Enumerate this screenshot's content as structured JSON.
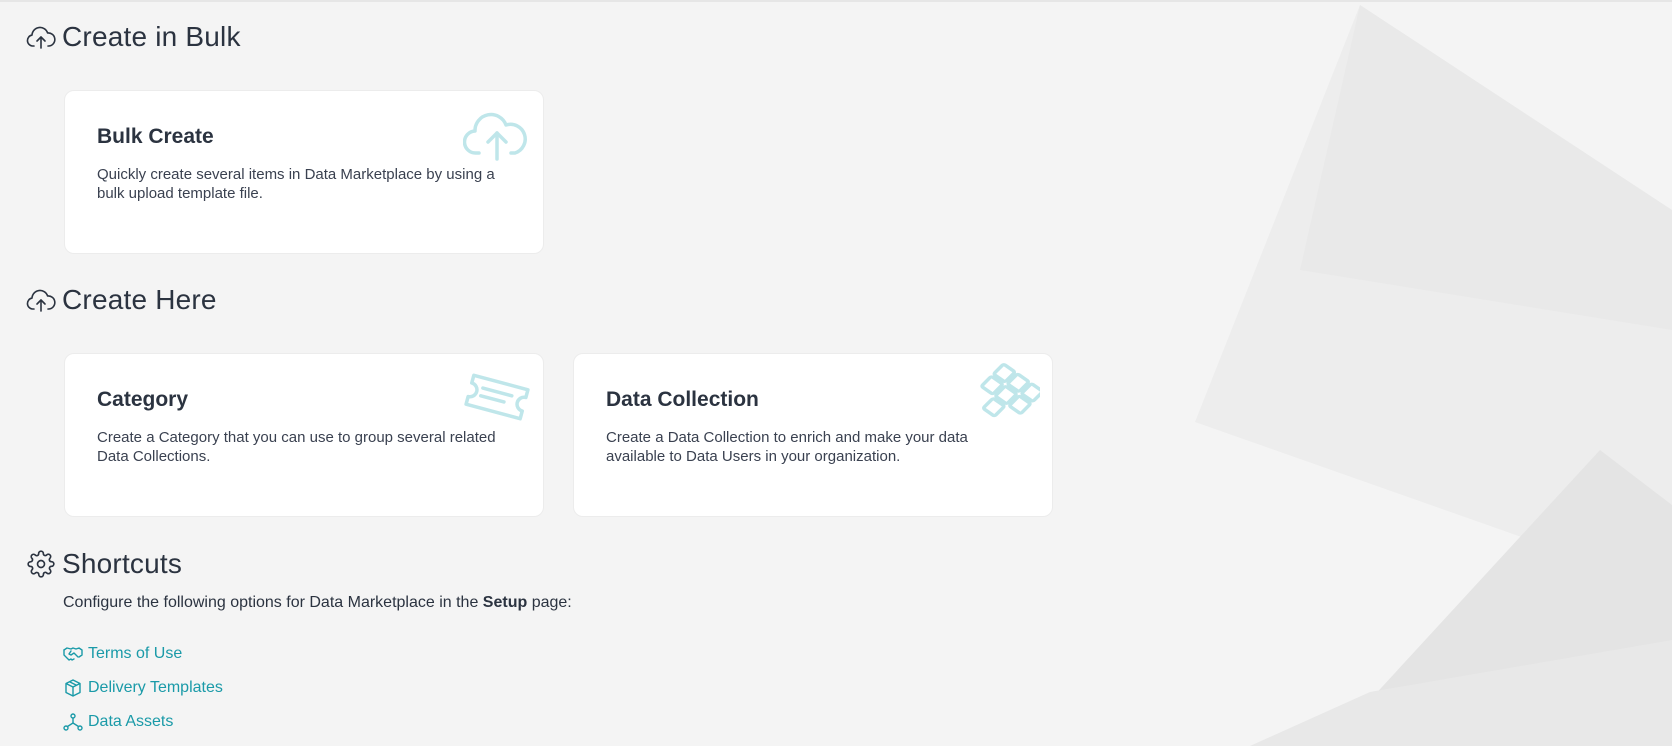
{
  "sections": {
    "bulk": {
      "title": "Create in Bulk",
      "cards": [
        {
          "title": "Bulk Create",
          "description": "Quickly create several items in Data Marketplace by using a bulk upload template file.",
          "icon": "cloud-upload-icon"
        }
      ]
    },
    "here": {
      "title": "Create Here",
      "cards": [
        {
          "title": "Category",
          "description": "Create a Category that you can use to group several related Data Collections.",
          "icon": "ticket-icon"
        },
        {
          "title": "Data Collection",
          "description": "Create a Data Collection to enrich and make your data available to Data Users in your organization.",
          "icon": "grid-stack-icon"
        }
      ]
    },
    "shortcuts": {
      "title": "Shortcuts",
      "desc_before": "Configure the following options for Data Marketplace in the ",
      "desc_bold": "Setup",
      "desc_after": " page:",
      "links": [
        {
          "label": "Terms of Use",
          "icon": "handshake-icon"
        },
        {
          "label": "Delivery Templates",
          "icon": "package-icon"
        },
        {
          "label": "Data Assets",
          "icon": "nodes-icon"
        }
      ]
    }
  },
  "colors": {
    "accent": "#1a9aa8",
    "card_icon": "#bfe6ea",
    "text": "#2b3340",
    "background": "#f4f4f4"
  }
}
